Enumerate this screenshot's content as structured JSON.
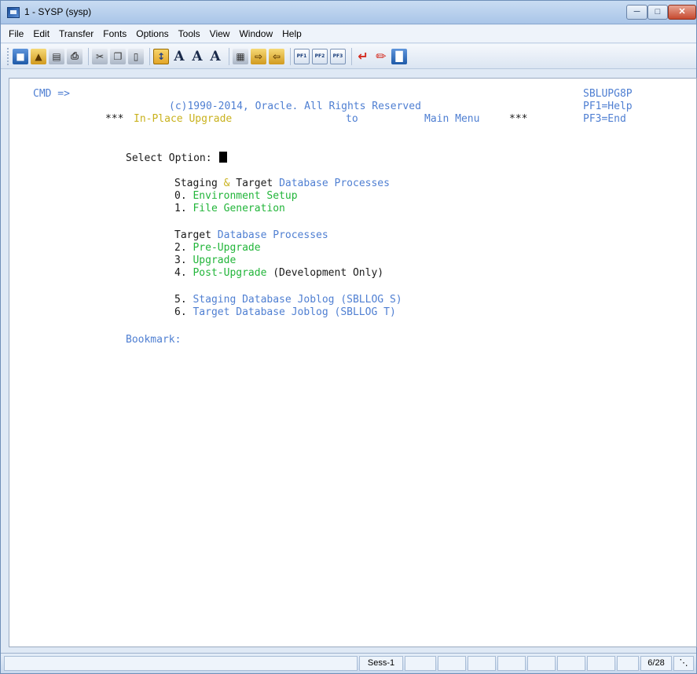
{
  "window": {
    "title": "1 - SYSP (sysp)"
  },
  "menu": [
    "File",
    "Edit",
    "Transfer",
    "Fonts",
    "Options",
    "Tools",
    "View",
    "Window",
    "Help"
  ],
  "toolbar": {
    "font_large": "A",
    "font_medium": "A",
    "font_small": "A",
    "pf_labels": [
      "PF1",
      "PF2",
      "PF3"
    ]
  },
  "screen": {
    "cmd_prompt": "CMD =>",
    "screen_id": "SBLUPG8P",
    "copyright": "(c)1990-2014, Oracle. All Rights Reserved",
    "pf1": "PF1=Help",
    "pf3": "PF3=End",
    "header_left_stars": "***",
    "header_mode": "In-Place Upgrade",
    "header_to": "to",
    "header_target": "Main Menu",
    "header_right_stars": "***",
    "select_option_label": "Select Option:",
    "section1": {
      "part1": "Staging",
      "amp": "&",
      "part2": "Target",
      "part3": "Database Processes"
    },
    "opt0": {
      "num": "0.",
      "label": "Environment Setup"
    },
    "opt1": {
      "num": "1.",
      "label": "File Generation"
    },
    "section2": {
      "part1": "Target",
      "part2": "Database Processes"
    },
    "opt2": {
      "num": "2.",
      "label": "Pre-Upgrade"
    },
    "opt3": {
      "num": "3.",
      "label": "Upgrade"
    },
    "opt4": {
      "num": "4.",
      "label": "Post-Upgrade",
      "note": "(Development Only)"
    },
    "opt5": {
      "num": "5.",
      "label": "Staging Database Joblog (SBLLOG S)"
    },
    "opt6": {
      "num": "6.",
      "label": "Target Database Joblog (SBLLOG T)"
    },
    "bookmark_label": "Bookmark:"
  },
  "status": {
    "session": "Sess-1",
    "position": "6/28"
  },
  "colors": {
    "terminal_blue": "#4f7fd2",
    "terminal_green": "#22b53a",
    "terminal_yellow": "#c9b21e"
  }
}
